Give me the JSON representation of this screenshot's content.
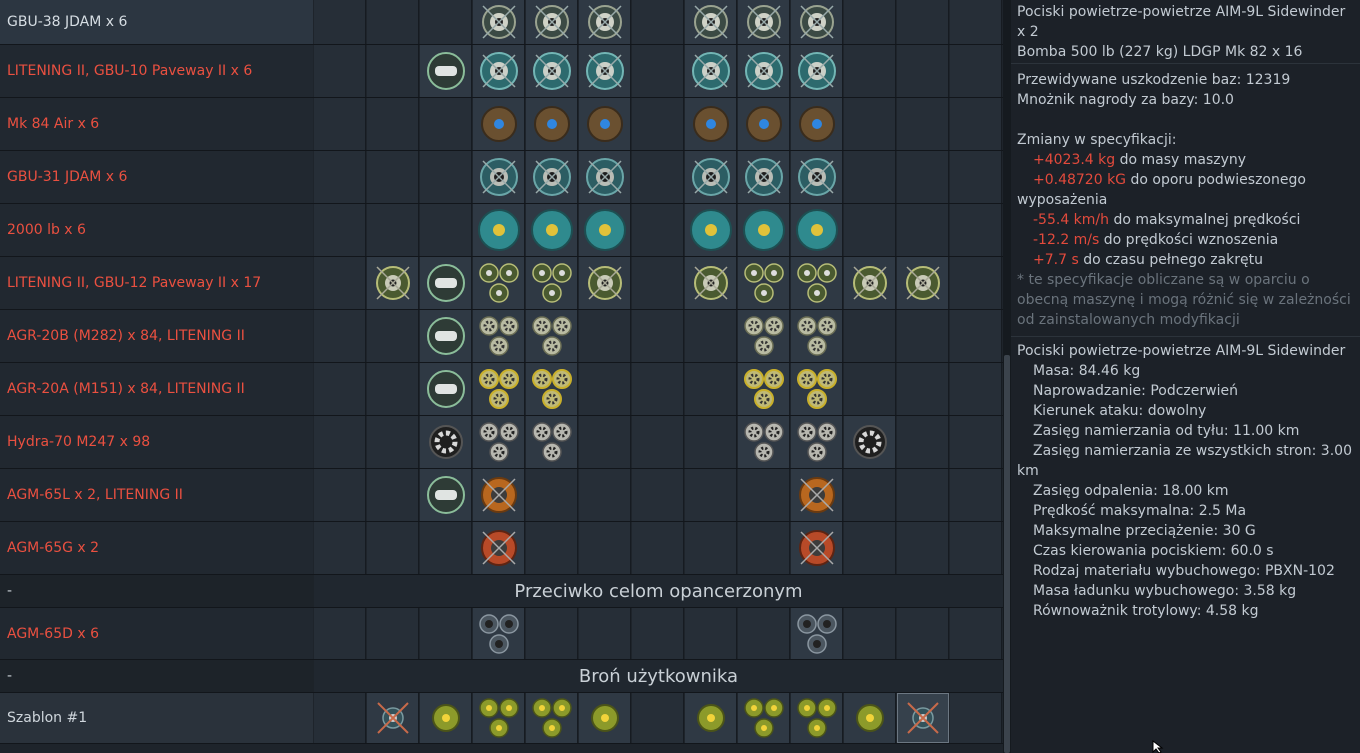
{
  "loadouts": [
    {
      "label": "GBU-38 JDAM x 6",
      "selected": true
    },
    {
      "label": "LITENING II,  GBU-10 Paveway II x 6"
    },
    {
      "label": "Mk 84 Air x 6"
    },
    {
      "label": "GBU-31 JDAM x 6"
    },
    {
      "label": "2000 lb x 6"
    },
    {
      "label": "LITENING II,  GBU-12 Paveway II x 17"
    },
    {
      "label": "AGR-20B (M282) x 84,  LITENING II"
    },
    {
      "label": "AGR-20A (M151) x 84,  LITENING II"
    },
    {
      "label": "Hydra-70 M247 x 98"
    },
    {
      "label": "AGM-65L x 2,  LITENING II"
    },
    {
      "label": "AGM-65G x 2"
    }
  ],
  "section_armored": {
    "dash": "-",
    "title": "Przeciwko celom opancerzonym"
  },
  "loadout_agm65d": {
    "label": "AGM-65D x 6"
  },
  "section_custom": {
    "dash": "-",
    "title": "Broń użytkownika"
  },
  "preset": {
    "label": "Szablon #1"
  },
  "info": {
    "line1": "Pociski powietrze-powietrze AIM-9L Sidewinder",
    "line2": "x 2",
    "line3": "Bomba 500 lb (227 kg) LDGP Mk 82 x 16",
    "damage": "Przewidywane uszkodzenie baz: 12319",
    "reward": "Mnożnik nagrody za bazy: 10.0",
    "changes_header": "Zmiany w specyfikacji:",
    "mass_val": "+4023.4 kg",
    "mass_txt": " do masy maszyny",
    "drag_val": "+0.48720  kG",
    "drag_txt": " do oporu podwieszonego",
    "drag_txt2": "wyposażenia",
    "speed_val": "-55.4 km/h",
    "speed_txt": " do maksymalnej prędkości",
    "climb_val": "-12.2 m/s",
    "climb_txt": " do prędkości wznoszenia",
    "turn_val": "+7.7 s",
    "turn_txt": " do czasu pełnego zakrętu",
    "note": "* te specyfikacje obliczane są w oparciu o obecną maszynę i mogą różnić się w zależności od zainstalowanych modyfikacji"
  },
  "missile": {
    "name": "Pociski powietrze-powietrze AIM-9L Sidewinder",
    "mass": "Masa: 84.46 kg",
    "guidance": "Naprowadzanie: Podczerwień",
    "aspect": "Kierunek ataku: dowolny",
    "rear_range": "Zasięg namierzania od tyłu: 11.00 km",
    "all_range_a": "Zasięg namierzania ze wszystkich stron: 3.00",
    "all_range_b": "km",
    "launch_range": "Zasięg odpalenia: 18.00 km",
    "max_speed": "Prędkość maksymalna: 2.5 Ma",
    "max_g": "Maksymalne przeciążenie: 30 G",
    "guidance_time": "Czas kierowania pociskiem: 60.0 s",
    "explosive": "Rodzaj materiału wybuchowego: PBXN-102",
    "explosive_mass": "Masa ładunku wybuchowego: 3.58 kg",
    "tnt": "Równoważnik trotylowy: 4.58 kg"
  }
}
